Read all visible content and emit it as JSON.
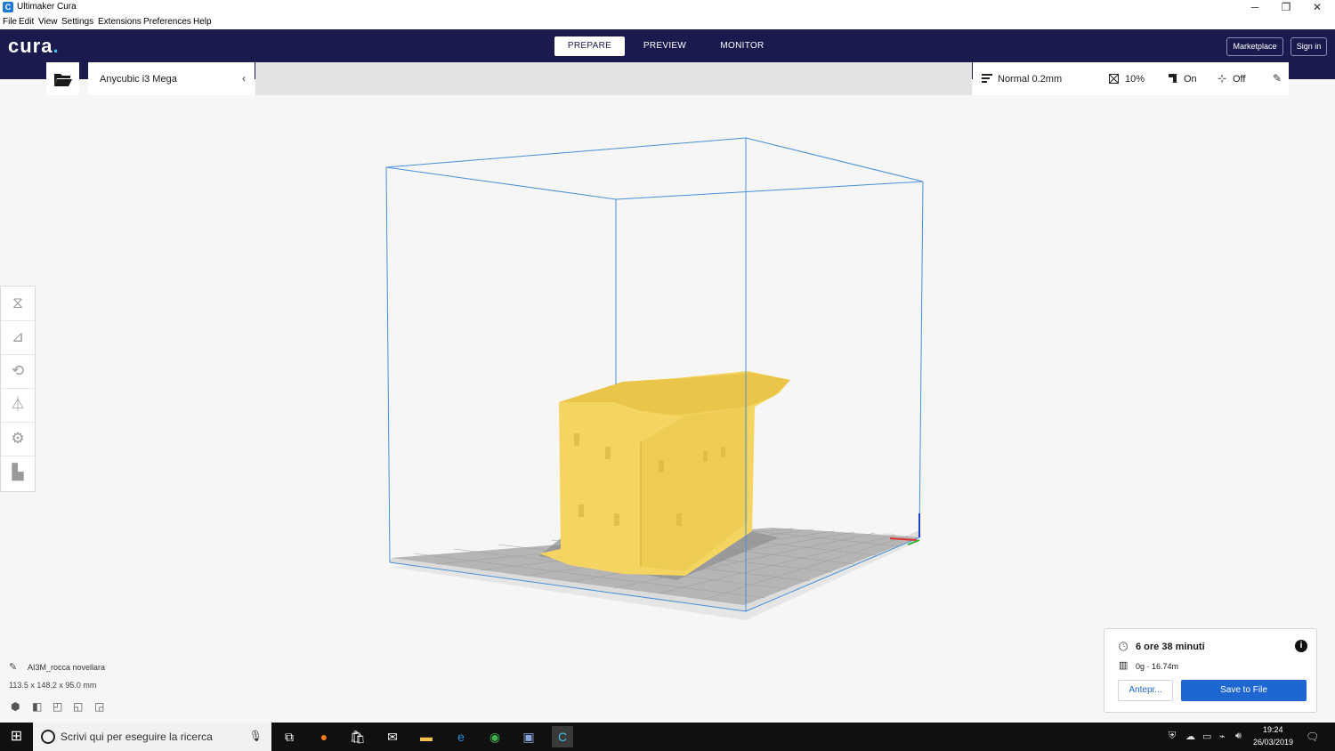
{
  "window": {
    "title": "Ultimaker Cura",
    "minimize": "─",
    "restore": "❐",
    "close": "✕"
  },
  "menu": [
    "File",
    "Edit",
    "View",
    "Settings",
    "Extensions",
    "Preferences",
    "Help"
  ],
  "header": {
    "logo_text": "cura",
    "logo_dot": ".",
    "tabs": [
      "PREPARE",
      "PREVIEW",
      "MONITOR"
    ],
    "active_tab": "PREPARE",
    "marketplace": "Marketplace",
    "signin": "Sign in"
  },
  "printer": {
    "name": "Anycubic i3 Mega"
  },
  "print_settings": {
    "profile": "Normal 0.2mm",
    "infill": "10%",
    "support": "On",
    "adhesion": "Off"
  },
  "object": {
    "name": "AI3M_rocca novellara",
    "dimensions": "113.5 x 148.2 x 95.0 mm"
  },
  "job": {
    "time": "6 ore 38 minuti",
    "material": "0g · 16.74m",
    "preview_label": "Antepr...",
    "save_label": "Save to File"
  },
  "taskbar": {
    "search_placeholder": "Scrivi qui per eseguire la ricerca",
    "time": "19:24",
    "date": "26/03/2019"
  },
  "colors": {
    "header_bg": "#1a1a4e",
    "accent": "#1e66d0",
    "model": "#f5d561",
    "build_volume": "#4a90d9"
  }
}
